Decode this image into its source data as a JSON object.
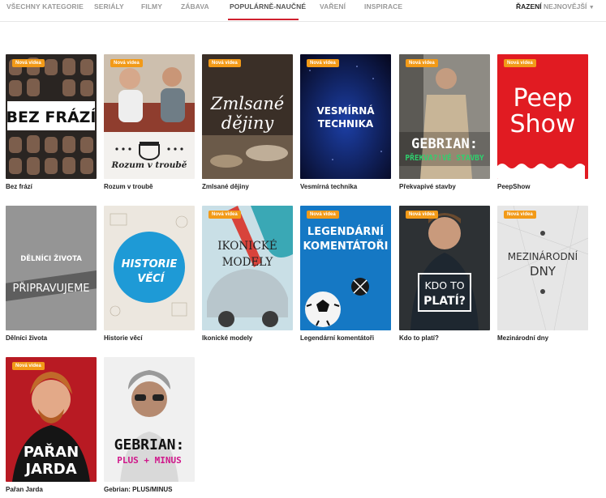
{
  "nav": {
    "tabs": [
      {
        "label": "VŠECHNY KATEGORIE"
      },
      {
        "label": "SERIÁLY"
      },
      {
        "label": "FILMY"
      },
      {
        "label": "ZÁBAVA"
      },
      {
        "label": "POPULÁRNĚ-NAUČNÉ"
      },
      {
        "label": "VAŘENÍ"
      },
      {
        "label": "INSPIRACE"
      }
    ],
    "active_tab": "POPULÁRNĚ-NAUČNÉ",
    "accent_color": "#d0202e"
  },
  "sort": {
    "label": "ŘAZENÍ",
    "value": "NEJNOVĚJŠÍ",
    "icon": "chevron-down-icon"
  },
  "badge_color": "#f29a18",
  "shows": [
    {
      "title": "Bez frází",
      "badge": "Nová videa",
      "poster_text": [
        "BEZ FRÁZÍ"
      ]
    },
    {
      "title": "Rozum v troubě",
      "badge": "Nová videa",
      "poster_text": [
        "Rozum v troubě"
      ]
    },
    {
      "title": "Zmlsané dějiny",
      "badge": "Nová videa",
      "poster_text": [
        "Zmlsané",
        "dějiny"
      ]
    },
    {
      "title": "Vesmírná technika",
      "badge": "Nová videa",
      "poster_text": [
        "VESMÍRNÁ",
        "TECHNIKA"
      ]
    },
    {
      "title": "Překvapivé stavby",
      "badge": "Nová videa",
      "poster_text": [
        "GEBRIAN:",
        "PŘEKVA?!VÉ STAVBY"
      ]
    },
    {
      "title": "PeepShow",
      "badge": "Nová videa",
      "poster_text": [
        "Peep",
        "Show"
      ]
    },
    {
      "title": "Dělníci života",
      "badge": "",
      "poster_text": [
        "DĚLNÍCI ŽIVOTA",
        "PŘIPRAVUJEME"
      ]
    },
    {
      "title": "Historie věcí",
      "badge": "",
      "poster_text": [
        "HISTORIE",
        "VĚCÍ"
      ]
    },
    {
      "title": "Ikonické modely",
      "badge": "Nová videa",
      "poster_text": [
        "IKONICKÉ",
        "MODELY"
      ]
    },
    {
      "title": "Legendární komentátoři",
      "badge": "Nová videa",
      "poster_text": [
        "LEGENDÁRNÍ",
        "KOMENTÁTOŘI"
      ]
    },
    {
      "title": "Kdo to platí?",
      "badge": "Nová videa",
      "poster_text": [
        "KDO TO",
        "PLATÍ?"
      ]
    },
    {
      "title": "Mezinárodní dny",
      "badge": "Nová videa",
      "poster_text": [
        "MEZINÁRODNÍ",
        "DNY"
      ]
    },
    {
      "title": "Pařan Jarda",
      "badge": "Nová videa",
      "poster_text": [
        "PAŘAN",
        "JARDA"
      ]
    },
    {
      "title": "Gebrian: PLUS/MINUS",
      "badge": "",
      "poster_text": [
        "GEBRIAN:",
        "PLUS + MINUS"
      ]
    }
  ]
}
